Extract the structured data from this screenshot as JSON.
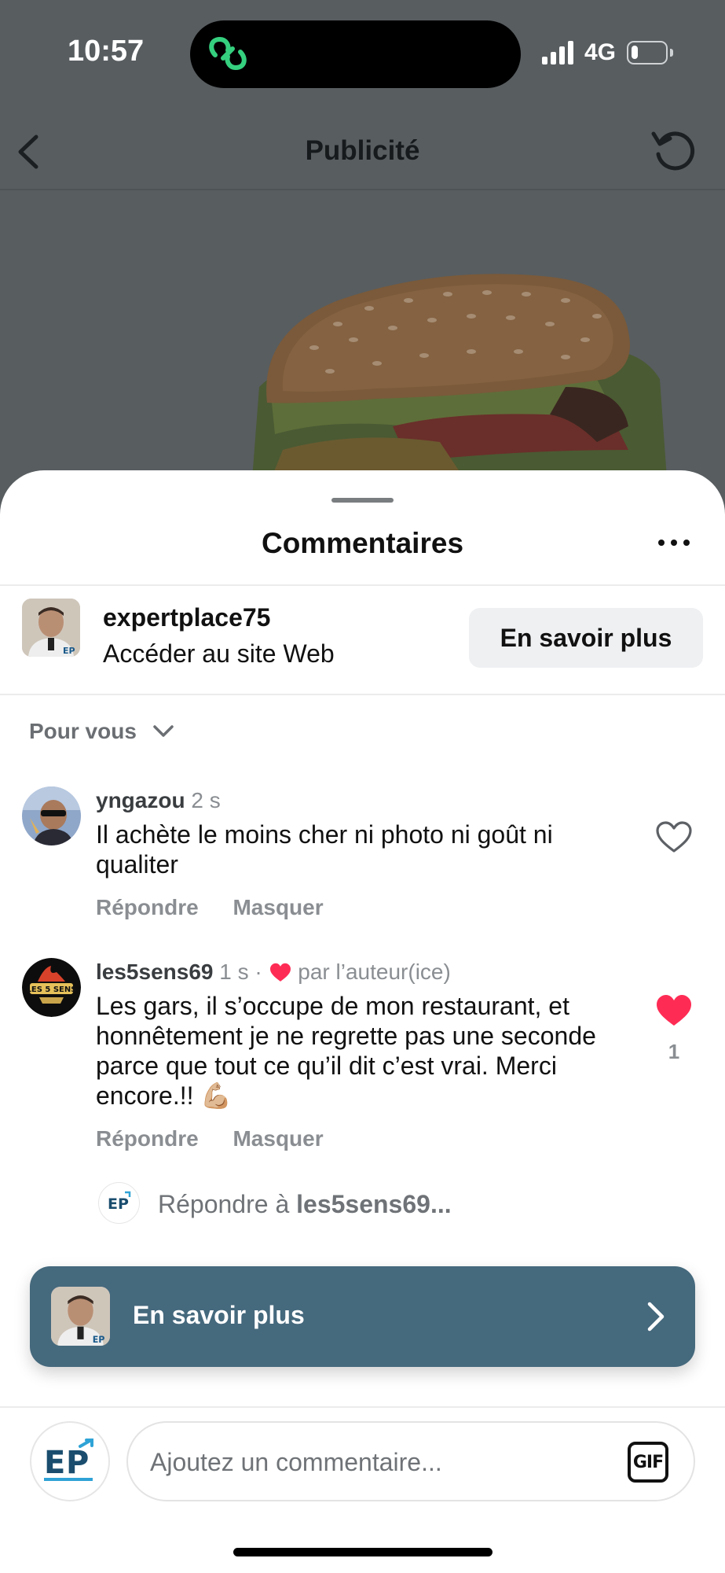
{
  "status_bar": {
    "time": "10:57",
    "network": "4G",
    "battery_level": 0.2,
    "icons": [
      "signal-bars-icon",
      "battery-icon",
      "activity-link-icon"
    ]
  },
  "nav": {
    "title": "Publicité",
    "back_icon": "chevron-left-icon",
    "refresh_icon": "refresh-icon"
  },
  "sheet": {
    "title": "Commentaires",
    "more_icon": "more-horizontal-icon"
  },
  "ad": {
    "account": "expertplace75",
    "subtitle": "Accéder au site Web",
    "button_label": "En savoir plus"
  },
  "sort": {
    "label": "Pour vous",
    "icon": "chevron-down-icon"
  },
  "comments": [
    {
      "user": "yngazou",
      "time": "2 s",
      "text": "Il achète le moins cher ni photo ni goût ni qualiter",
      "reply_label": "Répondre",
      "hide_label": "Masquer",
      "liked": false
    },
    {
      "user": "les5sens69",
      "time": "1 s ·",
      "author_like": "par l’auteur(ice)",
      "text": "Les gars, il s’occupe de mon restaurant, et honnêtement je ne regrette pas une seconde parce que tout ce qu’il dit c’est vrai. Merci encore.!! 💪🏼",
      "reply_label": "Répondre",
      "hide_label": "Masquer",
      "liked": true,
      "like_count": "1",
      "avatar_text": "LES 5 SENS"
    }
  ],
  "reply_prompt": {
    "prefix": "Répondre à ",
    "target": "les5sens69..."
  },
  "cta": {
    "label": "En savoir plus",
    "icon": "chevron-right-icon"
  },
  "composer": {
    "placeholder": "Ajoutez un commentaire...",
    "gif_label": "GIF",
    "logo_text": "EP"
  },
  "colors": {
    "cta_background": "#45697d",
    "like_red": "#fe2c55",
    "overlay": "#585d60"
  }
}
